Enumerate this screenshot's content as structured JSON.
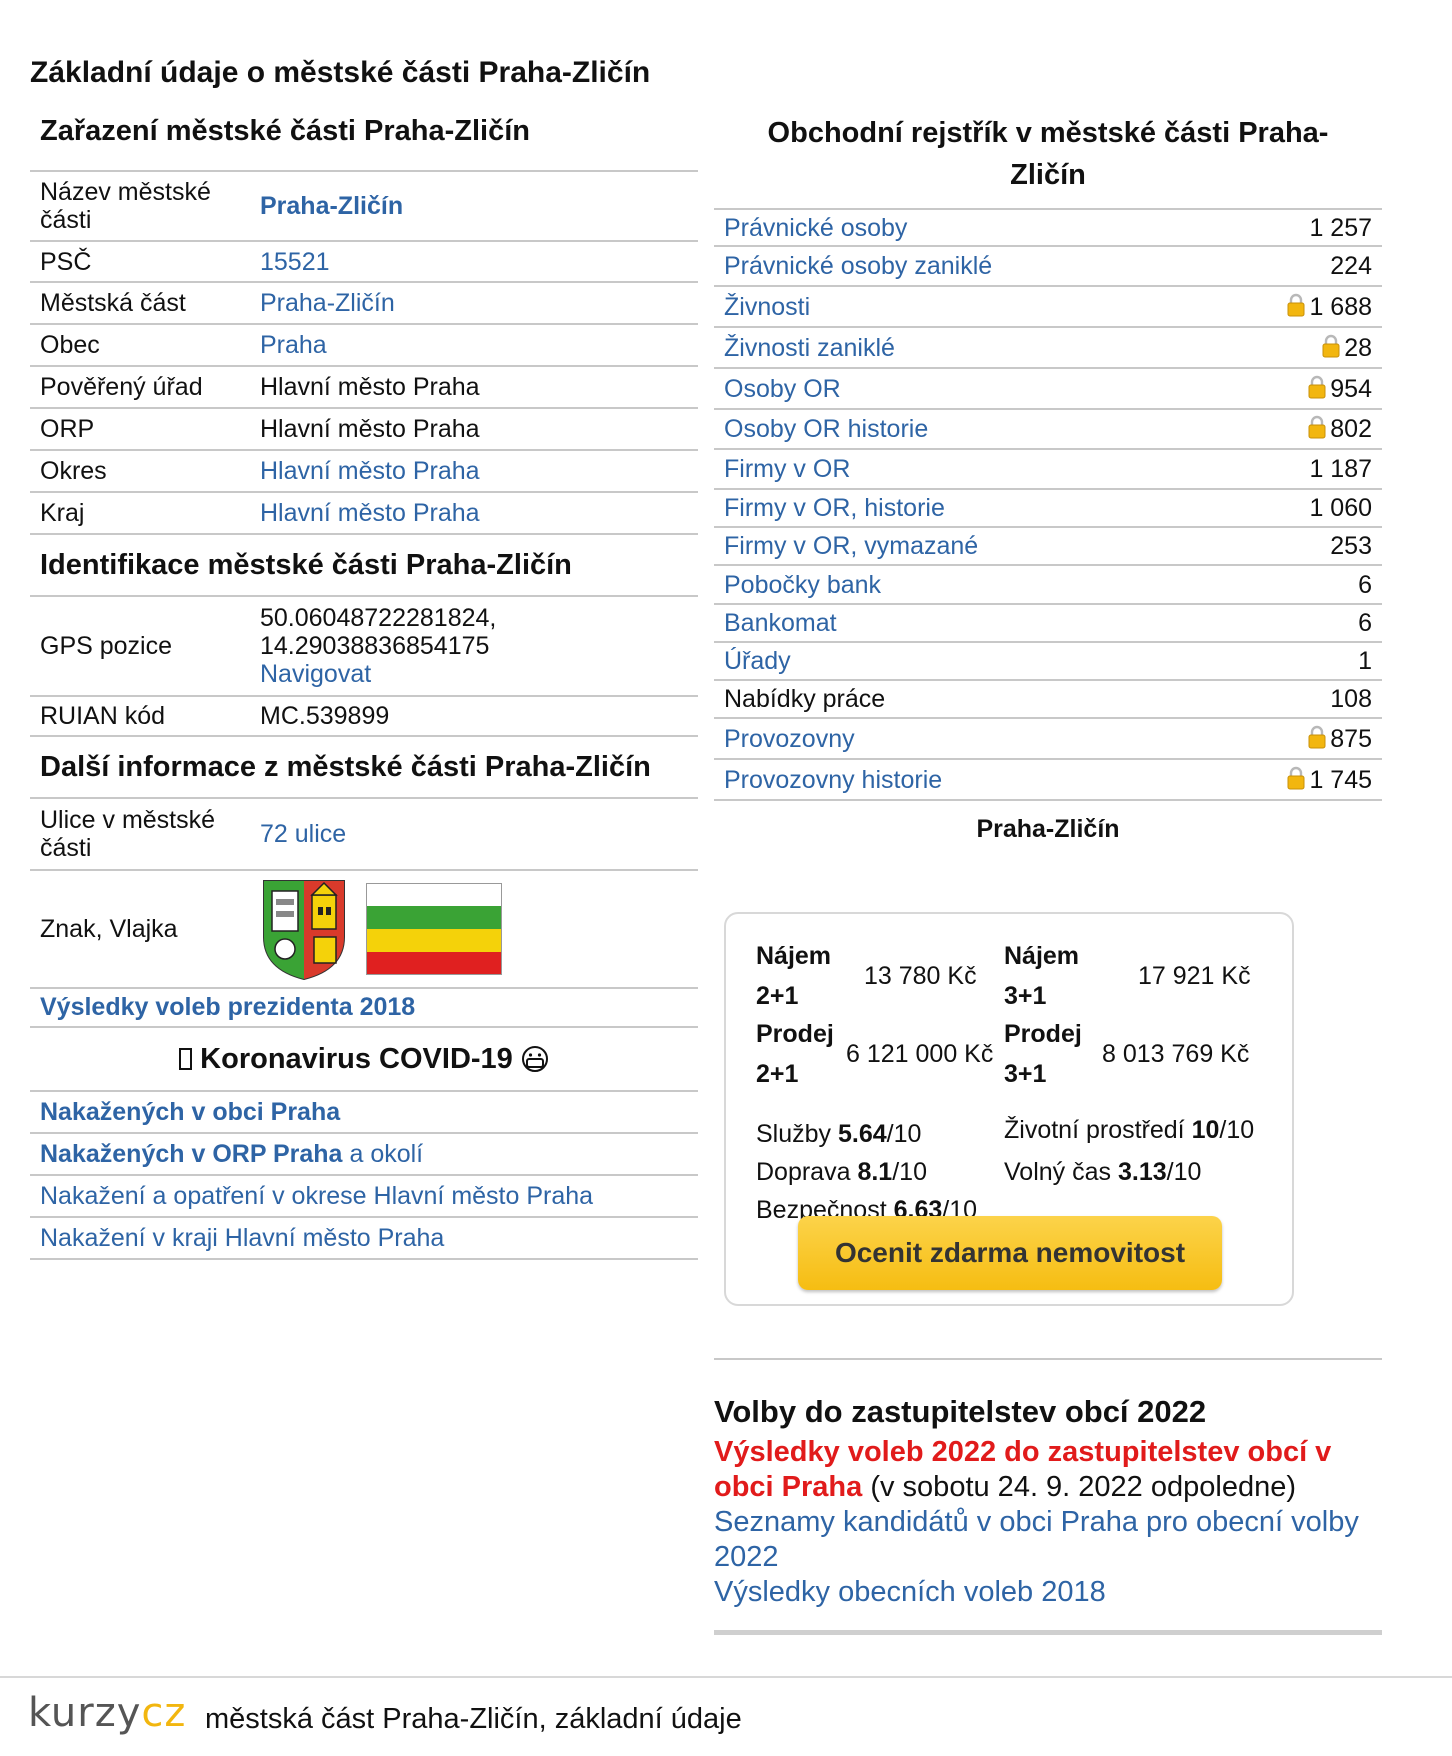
{
  "title": "Základní údaje o městské části Praha-Zličín",
  "zarazeni": {
    "heading": "Zařazení městské části Praha-Zličín",
    "rows": [
      {
        "label": "Název městské části",
        "value": "Praha-Zličín"
      },
      {
        "label": "PSČ",
        "value": "15521"
      },
      {
        "label": "Městská část",
        "value": "Praha-Zličín"
      },
      {
        "label": "Obec",
        "value": "Praha"
      },
      {
        "label": "Pověřený úřad",
        "value": "Hlavní město Praha"
      },
      {
        "label": "ORP",
        "value": "Hlavní město Praha"
      },
      {
        "label": "Okres",
        "value": "Hlavní město Praha"
      },
      {
        "label": "Kraj",
        "value": "Hlavní město Praha"
      }
    ]
  },
  "identifikace": {
    "heading": "Identifikace městské části Praha-Zličín",
    "gps_label": "GPS pozice",
    "gps_lat": "50.06048722281824,",
    "gps_lon": "14.29038836854175",
    "navigate": "Navigovat",
    "ruian_label": "RUIAN kód",
    "ruian_value": "MC.539899"
  },
  "dalsi": {
    "heading": "Další informace z městské části Praha-Zličín",
    "streets_label": "Ulice v městské části",
    "streets_value": "72 ulice",
    "emblem_label": "Znak, Vlajka",
    "elections_link": "Výsledky voleb prezidenta 2018"
  },
  "covid": {
    "heading": "Koronavirus COVID-19",
    "infected_obec": "Nakažených v obci Praha",
    "infected_orp": "Nakažených v ORP Praha",
    "infected_orp_suffix": "a okolí",
    "okres": "Nakažení a opatření v okrese Hlavní město Praha",
    "kraj": "Nakažení v kraji Hlavní město Praha"
  },
  "or": {
    "heading": "Obchodní rejstřík v městské části Praha-Zličín",
    "rows": [
      {
        "label": "Právnické osoby",
        "value": "1 257",
        "lock": false,
        "link": true
      },
      {
        "label": "Právnické osoby zaniklé",
        "value": "224",
        "lock": false,
        "link": true
      },
      {
        "label": "Živnosti",
        "value": "1 688",
        "lock": true,
        "link": true
      },
      {
        "label": "Živnosti zaniklé",
        "value": "28",
        "lock": true,
        "link": true
      },
      {
        "label": "Osoby OR",
        "value": "954",
        "lock": true,
        "link": true
      },
      {
        "label": "Osoby OR historie",
        "value": "802",
        "lock": true,
        "link": true
      },
      {
        "label": "Firmy v OR",
        "value": "1 187",
        "lock": false,
        "link": true
      },
      {
        "label": "Firmy v OR, historie",
        "value": "1 060",
        "lock": false,
        "link": true
      },
      {
        "label": "Firmy v OR, vymazané",
        "value": "253",
        "lock": false,
        "link": true
      },
      {
        "label": "Pobočky bank",
        "value": "6",
        "lock": false,
        "link": true
      },
      {
        "label": "Bankomat",
        "value": "6",
        "lock": false,
        "link": true
      },
      {
        "label": "Úřady",
        "value": "1",
        "lock": false,
        "link": true
      },
      {
        "label": "Nabídky práce",
        "value": "108",
        "lock": false,
        "link": false
      },
      {
        "label": "Provozovny",
        "value": "875",
        "lock": true,
        "link": true
      },
      {
        "label": "Provozovny historie",
        "value": "1 745",
        "lock": true,
        "link": true
      }
    ]
  },
  "realty": {
    "title": "Praha-Zličín",
    "najem21_label": "Nájem 2+1",
    "najem21_value": "13 780 Kč",
    "najem31_label": "Nájem 3+1",
    "najem31_value": "17 921 Kč",
    "prodej21_label": "Prodej 2+1",
    "prodej21_value": "6 121 000 Kč",
    "prodej31_label": "Prodej 3+1",
    "prodej31_value": "8 013 769 Kč",
    "scores": [
      {
        "label": "Služby",
        "value": "5.64",
        "suffix": "/10"
      },
      {
        "label": "Životní prostředí",
        "value": "10",
        "suffix": "/10"
      },
      {
        "label": "Doprava",
        "value": "8.1",
        "suffix": "/10"
      },
      {
        "label": "Volný čas",
        "value": "3.13",
        "suffix": "/10"
      },
      {
        "label": "Bezpečnost",
        "value": "6.63",
        "suffix": "/10"
      }
    ],
    "cta": "Ocenit zdarma nemovitost"
  },
  "elections": {
    "heading": "Volby do zastupitelstev obcí 2022",
    "results_link": "Výsledky voleb 2022 do zastupitelstev obcí v obci Praha",
    "results_note": "(v sobotu 24. 9. 2022 odpoledne)",
    "candidates_link": "Seznamy kandidátů v obci Praha pro obecní volby 2022",
    "results2018_link": "Výsledky obecních voleb 2018"
  },
  "footer": {
    "logo_kurzy": "kurzy",
    "logo_cz": "cz",
    "text": "městská část Praha-Zličín, základní údaje"
  },
  "colors": {
    "link": "#2e64a5",
    "red": "#e11b1b",
    "button": "#f6bd12",
    "flag_white": "#ffffff",
    "flag_green": "#3aa335",
    "flag_yellow": "#f4d20a",
    "flag_red": "#e02020"
  }
}
